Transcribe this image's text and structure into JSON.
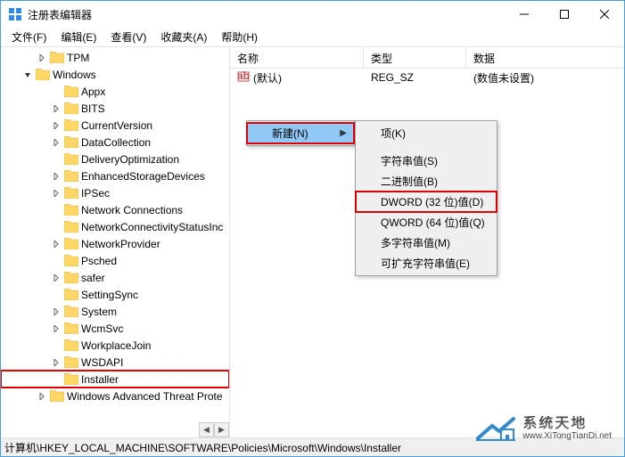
{
  "window": {
    "title": "注册表编辑器"
  },
  "menubar": {
    "file": "文件(F)",
    "edit": "编辑(E)",
    "view": "查看(V)",
    "favorites": "收藏夹(A)",
    "help": "帮助(H)"
  },
  "tree": {
    "nodes": [
      {
        "label": "TPM",
        "indent": 40,
        "expander": "right"
      },
      {
        "label": "Windows",
        "indent": 24,
        "expander": "down"
      },
      {
        "label": "Appx",
        "indent": 56,
        "expander": "none"
      },
      {
        "label": "BITS",
        "indent": 56,
        "expander": "right"
      },
      {
        "label": "CurrentVersion",
        "indent": 56,
        "expander": "right"
      },
      {
        "label": "DataCollection",
        "indent": 56,
        "expander": "right"
      },
      {
        "label": "DeliveryOptimization",
        "indent": 56,
        "expander": "none"
      },
      {
        "label": "EnhancedStorageDevices",
        "indent": 56,
        "expander": "right"
      },
      {
        "label": "IPSec",
        "indent": 56,
        "expander": "right"
      },
      {
        "label": "Network Connections",
        "indent": 56,
        "expander": "none"
      },
      {
        "label": "NetworkConnectivityStatusInc",
        "indent": 56,
        "expander": "none"
      },
      {
        "label": "NetworkProvider",
        "indent": 56,
        "expander": "right"
      },
      {
        "label": "Psched",
        "indent": 56,
        "expander": "none"
      },
      {
        "label": "safer",
        "indent": 56,
        "expander": "right"
      },
      {
        "label": "SettingSync",
        "indent": 56,
        "expander": "none"
      },
      {
        "label": "System",
        "indent": 56,
        "expander": "right"
      },
      {
        "label": "WcmSvc",
        "indent": 56,
        "expander": "right"
      },
      {
        "label": "WorkplaceJoin",
        "indent": 56,
        "expander": "none"
      },
      {
        "label": "WSDAPI",
        "indent": 56,
        "expander": "right"
      },
      {
        "label": "Installer",
        "indent": 56,
        "expander": "none",
        "highlighted": true
      },
      {
        "label": "Windows Advanced Threat Prote",
        "indent": 40,
        "expander": "right"
      }
    ]
  },
  "list": {
    "headers": {
      "name": "名称",
      "type": "类型",
      "data": "数据"
    },
    "rows": [
      {
        "name": "(默认)",
        "type": "REG_SZ",
        "data": "(数值未设置)"
      }
    ]
  },
  "context_primary": {
    "new": "新建(N)"
  },
  "context_secondary": {
    "key": "项(K)",
    "string": "字符串值(S)",
    "binary": "二进制值(B)",
    "dword": "DWORD (32 位)值(D)",
    "qword": "QWORD (64 位)值(Q)",
    "multi": "多字符串值(M)",
    "expand": "可扩充字符串值(E)"
  },
  "statusbar": {
    "path": "计算机\\HKEY_LOCAL_MACHINE\\SOFTWARE\\Policies\\Microsoft\\Windows\\Installer"
  },
  "watermark": {
    "cn": "系统天地",
    "en": "www.XiTongTianDi.net"
  }
}
